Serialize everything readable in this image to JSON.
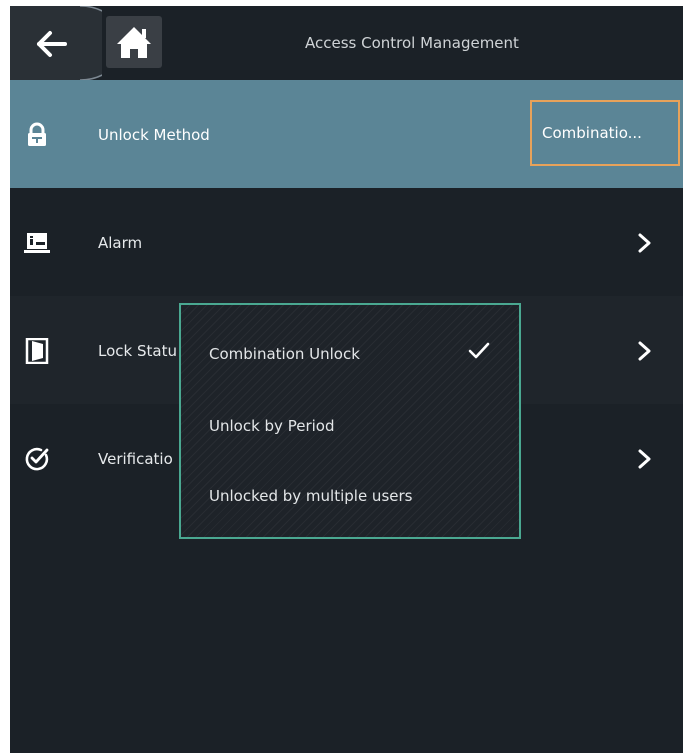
{
  "header": {
    "title": "Access Control Management",
    "back_icon": "arrow-left-icon",
    "home_icon": "home-icon"
  },
  "menu": {
    "items": [
      {
        "label": "Unlock Method",
        "icon": "lock-icon",
        "value": "Combinatio...",
        "selected": true
      },
      {
        "label": "Alarm",
        "icon": "alarm-icon"
      },
      {
        "label": "Lock Statu",
        "icon": "door-icon"
      },
      {
        "label": "Verificatio",
        "icon": "verify-check-icon"
      }
    ]
  },
  "dropdown": {
    "options": [
      {
        "label": "Combination Unlock",
        "checked": true
      },
      {
        "label": "Unlock by Period",
        "checked": false
      },
      {
        "label": "Unlocked by multiple users",
        "checked": false
      }
    ]
  },
  "colors": {
    "background": "#1b2127",
    "selected_row": "#5b8596",
    "highlight_border": "#e8a25a",
    "popup_border": "#4aa891",
    "text": "#e6e9eb"
  }
}
